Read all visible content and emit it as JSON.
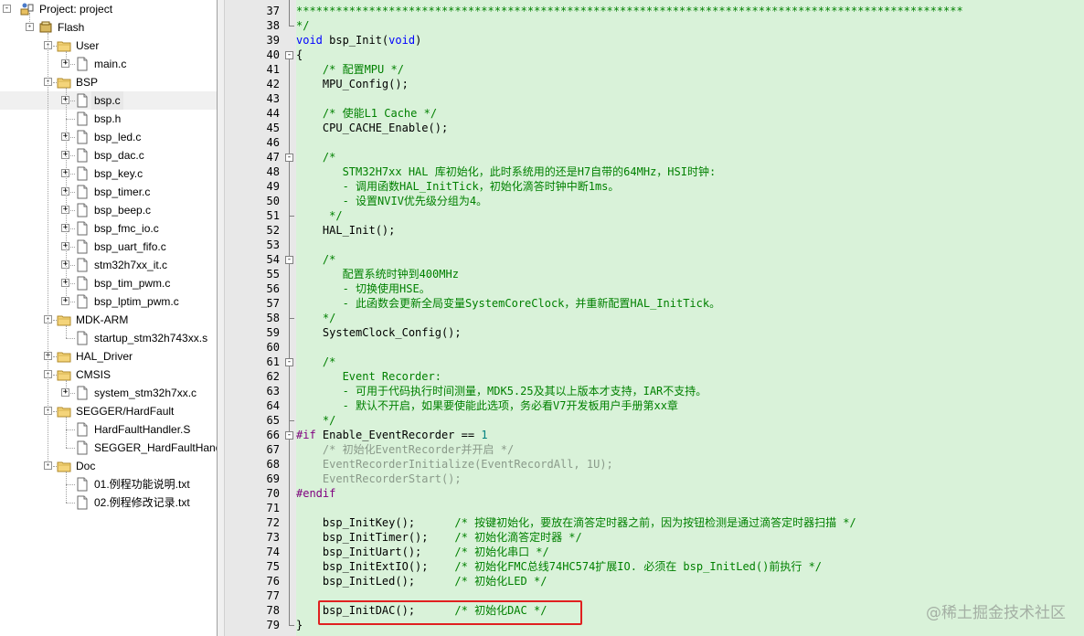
{
  "tree": {
    "project_label": "Project: project",
    "target_label": "Flash",
    "groups": [
      {
        "label": "User",
        "files": [
          "main.c"
        ]
      },
      {
        "label": "BSP",
        "files": [
          "bsp.c",
          "bsp.h",
          "bsp_led.c",
          "bsp_dac.c",
          "bsp_key.c",
          "bsp_timer.c",
          "bsp_beep.c",
          "bsp_fmc_io.c",
          "bsp_uart_fifo.c",
          "stm32h7xx_it.c",
          "bsp_tim_pwm.c",
          "bsp_lptim_pwm.c"
        ]
      },
      {
        "label": "MDK-ARM",
        "files": [
          "startup_stm32h743xx.s"
        ]
      },
      {
        "label": "HAL_Driver",
        "files": []
      },
      {
        "label": "CMSIS",
        "files": [
          "system_stm32h7xx.c"
        ]
      },
      {
        "label": "SEGGER/HardFault",
        "files": [
          "HardFaultHandler.S",
          "SEGGER_HardFaultHandl"
        ]
      },
      {
        "label": "Doc",
        "files": [
          "01.例程功能说明.txt",
          "02.例程修改记录.txt"
        ]
      }
    ],
    "selected_file": "bsp.c"
  },
  "code": {
    "lines": [
      {
        "n": "37",
        "text": "*****************************************************************************************************"
      },
      {
        "n": "38",
        "text": "*/"
      },
      {
        "n": "39",
        "text": "void bsp_Init(void)"
      },
      {
        "n": "40",
        "text": "{"
      },
      {
        "n": "41",
        "text": "    /* 配置MPU */"
      },
      {
        "n": "42",
        "text": "    MPU_Config();"
      },
      {
        "n": "43",
        "text": ""
      },
      {
        "n": "44",
        "text": "    /* 使能L1 Cache */"
      },
      {
        "n": "45",
        "text": "    CPU_CACHE_Enable();"
      },
      {
        "n": "46",
        "text": ""
      },
      {
        "n": "47",
        "text": "    /*"
      },
      {
        "n": "48",
        "text": "       STM32H7xx HAL 库初始化，此时系统用的还是H7自带的64MHz，HSI时钟:"
      },
      {
        "n": "49",
        "text": "       - 调用函数HAL_InitTick，初始化滴答时钟中断1ms。"
      },
      {
        "n": "50",
        "text": "       - 设置NVIV优先级分组为4。"
      },
      {
        "n": "51",
        "text": "     */"
      },
      {
        "n": "52",
        "text": "    HAL_Init();"
      },
      {
        "n": "53",
        "text": ""
      },
      {
        "n": "54",
        "text": "    /*"
      },
      {
        "n": "55",
        "text": "       配置系统时钟到400MHz"
      },
      {
        "n": "56",
        "text": "       - 切换使用HSE。"
      },
      {
        "n": "57",
        "text": "       - 此函数会更新全局变量SystemCoreClock，并重新配置HAL_InitTick。"
      },
      {
        "n": "58",
        "text": "    */"
      },
      {
        "n": "59",
        "text": "    SystemClock_Config();"
      },
      {
        "n": "60",
        "text": ""
      },
      {
        "n": "61",
        "text": "    /*"
      },
      {
        "n": "62",
        "text": "       Event Recorder:"
      },
      {
        "n": "63",
        "text": "       - 可用于代码执行时间测量，MDK5.25及其以上版本才支持，IAR不支持。"
      },
      {
        "n": "64",
        "text": "       - 默认不开启，如果要使能此选项，务必看V7开发板用户手册第xx章"
      },
      {
        "n": "65",
        "text": "    */"
      },
      {
        "n": "66",
        "text": "#if Enable_EventRecorder == 1"
      },
      {
        "n": "67",
        "text": "    /* 初始化EventRecorder并开启 */"
      },
      {
        "n": "68",
        "text": "    EventRecorderInitialize(EventRecordAll, 1U);"
      },
      {
        "n": "69",
        "text": "    EventRecorderStart();"
      },
      {
        "n": "70",
        "text": "#endif"
      },
      {
        "n": "71",
        "text": ""
      },
      {
        "n": "72",
        "text": "    bsp_InitKey();      /* 按键初始化，要放在滴答定时器之前，因为按钮检测是通过滴答定时器扫描 */"
      },
      {
        "n": "73",
        "text": "    bsp_InitTimer();    /* 初始化滴答定时器 */"
      },
      {
        "n": "74",
        "text": "    bsp_InitUart();     /* 初始化串口 */"
      },
      {
        "n": "75",
        "text": "    bsp_InitExtIO();    /* 初始化FMC总线74HC574扩展IO. 必须在 bsp_InitLed()前执行 */"
      },
      {
        "n": "76",
        "text": "    bsp_InitLed();      /* 初始化LED */"
      },
      {
        "n": "77",
        "text": ""
      },
      {
        "n": "78",
        "text": "    bsp_InitDAC();      /* 初始化DAC */"
      },
      {
        "n": "79",
        "text": "}"
      }
    ]
  },
  "watermark": "@稀土掘金技术社区",
  "colors": {
    "editor_bg": "#d9f2d9",
    "comment": "#008000",
    "keyword": "#0000ff",
    "preprocessor": "#800080",
    "highlight_box": "#e02020"
  }
}
